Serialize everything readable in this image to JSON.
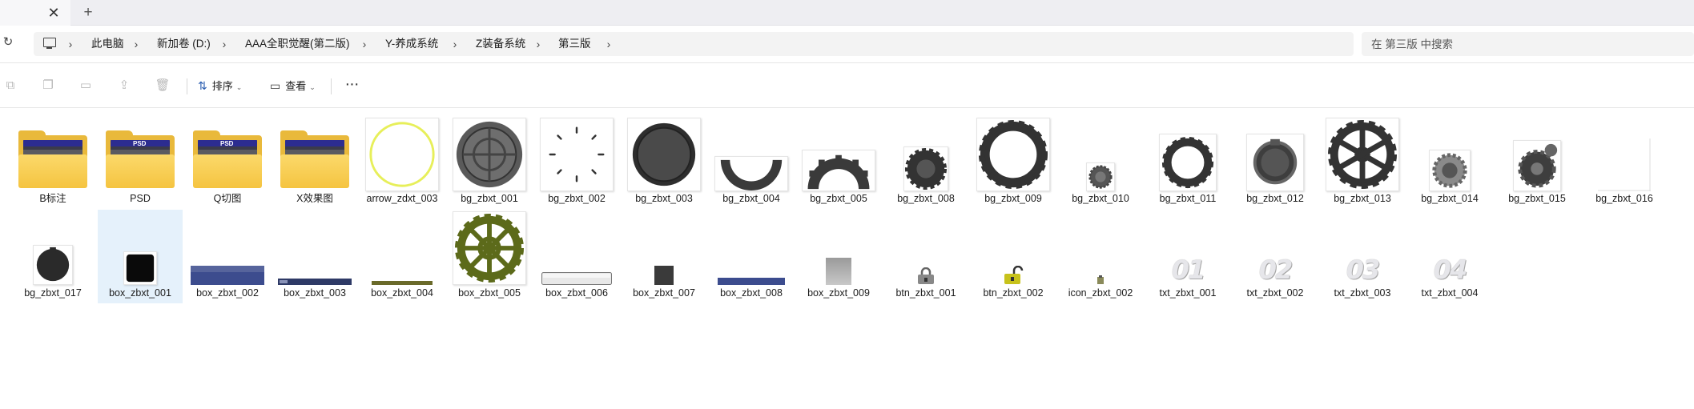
{
  "tabbar": {
    "close_glyph": "✕",
    "add_glyph": "+"
  },
  "address": {
    "refresh_glyph": "↻",
    "crumbs": [
      "此电脑",
      "新加卷 (D:)",
      "AAA全职觉醒(第二版)",
      "Y-养成系统",
      "Z装备系统",
      "第三版"
    ],
    "separator": "›",
    "search_placeholder": "在 第三版 中搜索"
  },
  "toolbar": {
    "new_icon": "new-item-icon",
    "copy_icon": "copy-icon",
    "rename_icon": "rename-icon",
    "share_icon": "share-icon",
    "delete_icon": "delete-icon",
    "sort_label": "排序",
    "view_label": "查看",
    "more_glyph": "···"
  },
  "files": {
    "row1": [
      "B标注",
      "PSD",
      "Q切图",
      "X效果图",
      "arrow_zdxt_003",
      "bg_zbxt_001",
      "bg_zbxt_002",
      "bg_zbxt_003",
      "bg_zbxt_004",
      "bg_zbxt_005",
      "bg_zbxt_008",
      "bg_zbxt_009",
      "bg_zbxt_010",
      "bg_zbxt_011",
      "bg_zbxt_012",
      "bg_zbxt_013",
      "bg_zbxt_014",
      "bg_zbxt_015",
      "bg_zbxt_016"
    ],
    "row2": [
      "bg_zbxt_017",
      "box_zbxt_001",
      "box_zbxt_002",
      "box_zbxt_003",
      "box_zbxt_004",
      "box_zbxt_005",
      "box_zbxt_006",
      "box_zbxt_007",
      "box_zbxt_008",
      "box_zbxt_009",
      "btn_zbxt_001",
      "btn_zbxt_002",
      "icon_zbxt_002",
      "txt_zbxt_001",
      "txt_zbxt_002",
      "txt_zbxt_003",
      "txt_zbxt_004"
    ],
    "folder_psd_text": "PSD",
    "txt_images": [
      "01",
      "02",
      "03",
      "04"
    ]
  },
  "colors": {
    "accent": "#2a5db0",
    "selection": "#e5f1fb",
    "folder": "#f5c441",
    "gear_dark": "#3a3a3a",
    "gear_olive": "#5c6a1a",
    "arrow_ring": "#e7ef5a"
  }
}
